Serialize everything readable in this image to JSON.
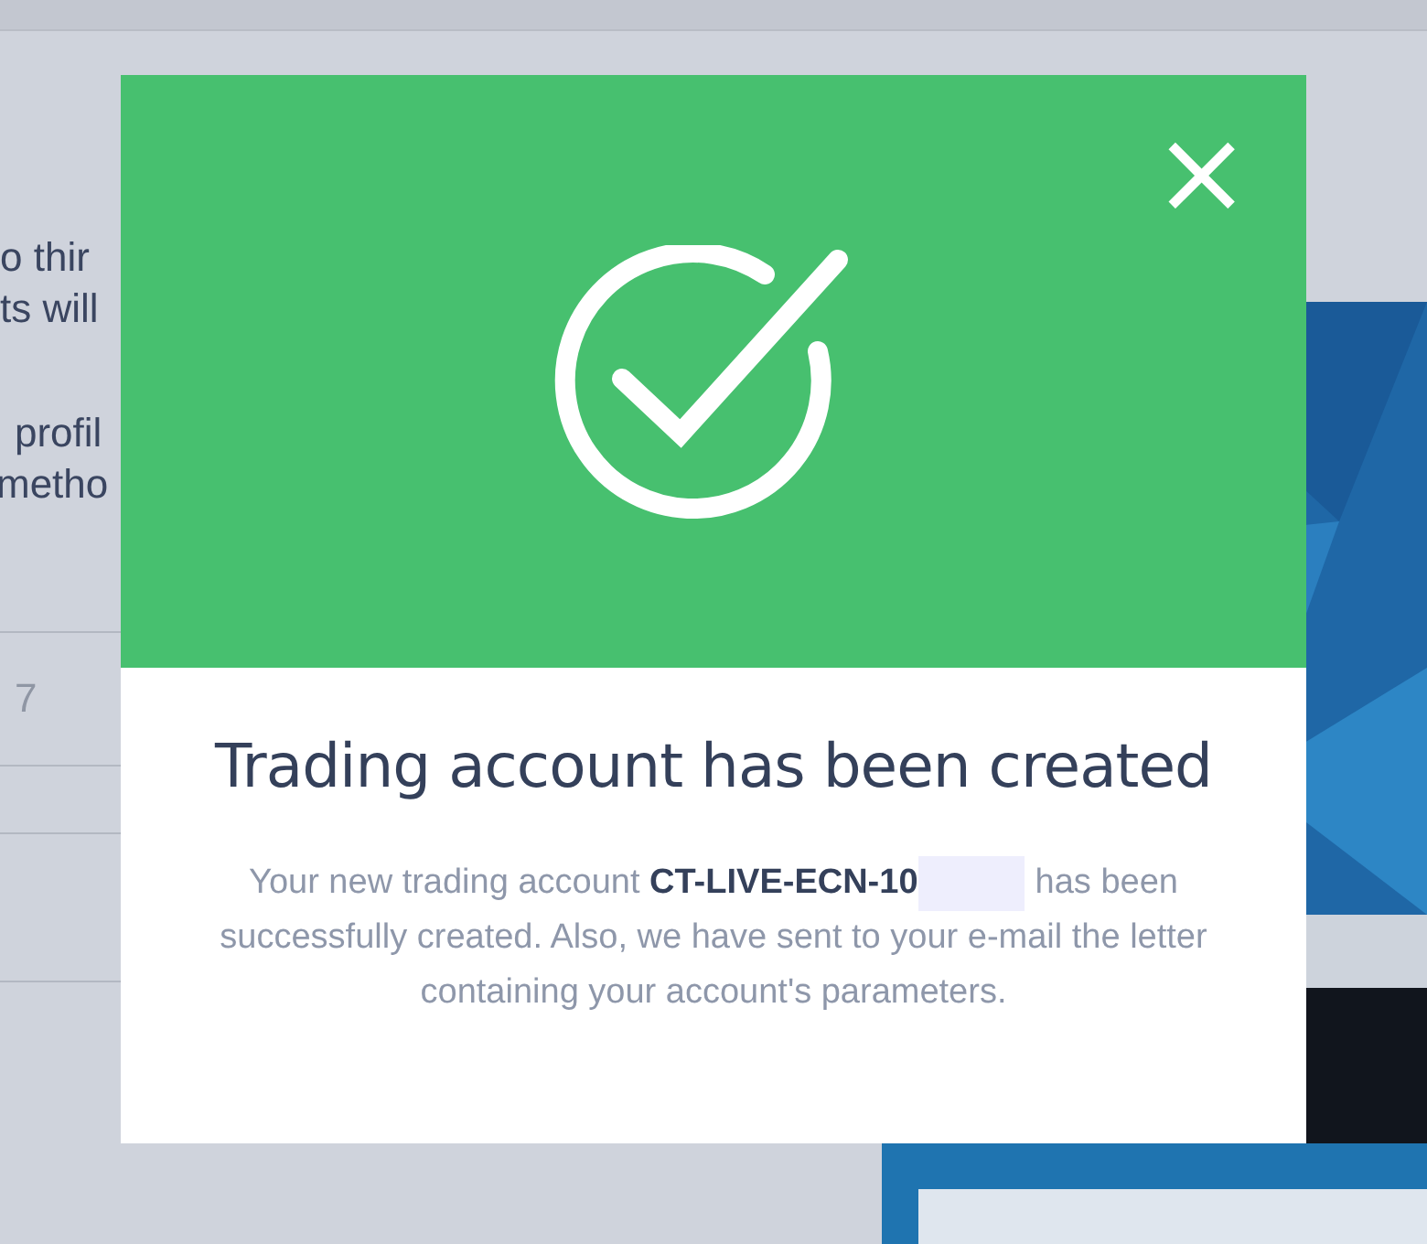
{
  "background_page": {
    "text_lines": [
      "o thir",
      "ts will",
      "profil",
      "metho"
    ],
    "table_rows": [
      {
        "cell": "7"
      },
      {},
      {},
      {}
    ]
  },
  "modal": {
    "close_label": "×",
    "title": "Trading account has been created",
    "message_before": "Your new trading account **CT-LIVE-ECN-10**",
    "message_after": "has been successfully created. Also, we have sent to your e-mail the letter containing your account's parameters."
  }
}
